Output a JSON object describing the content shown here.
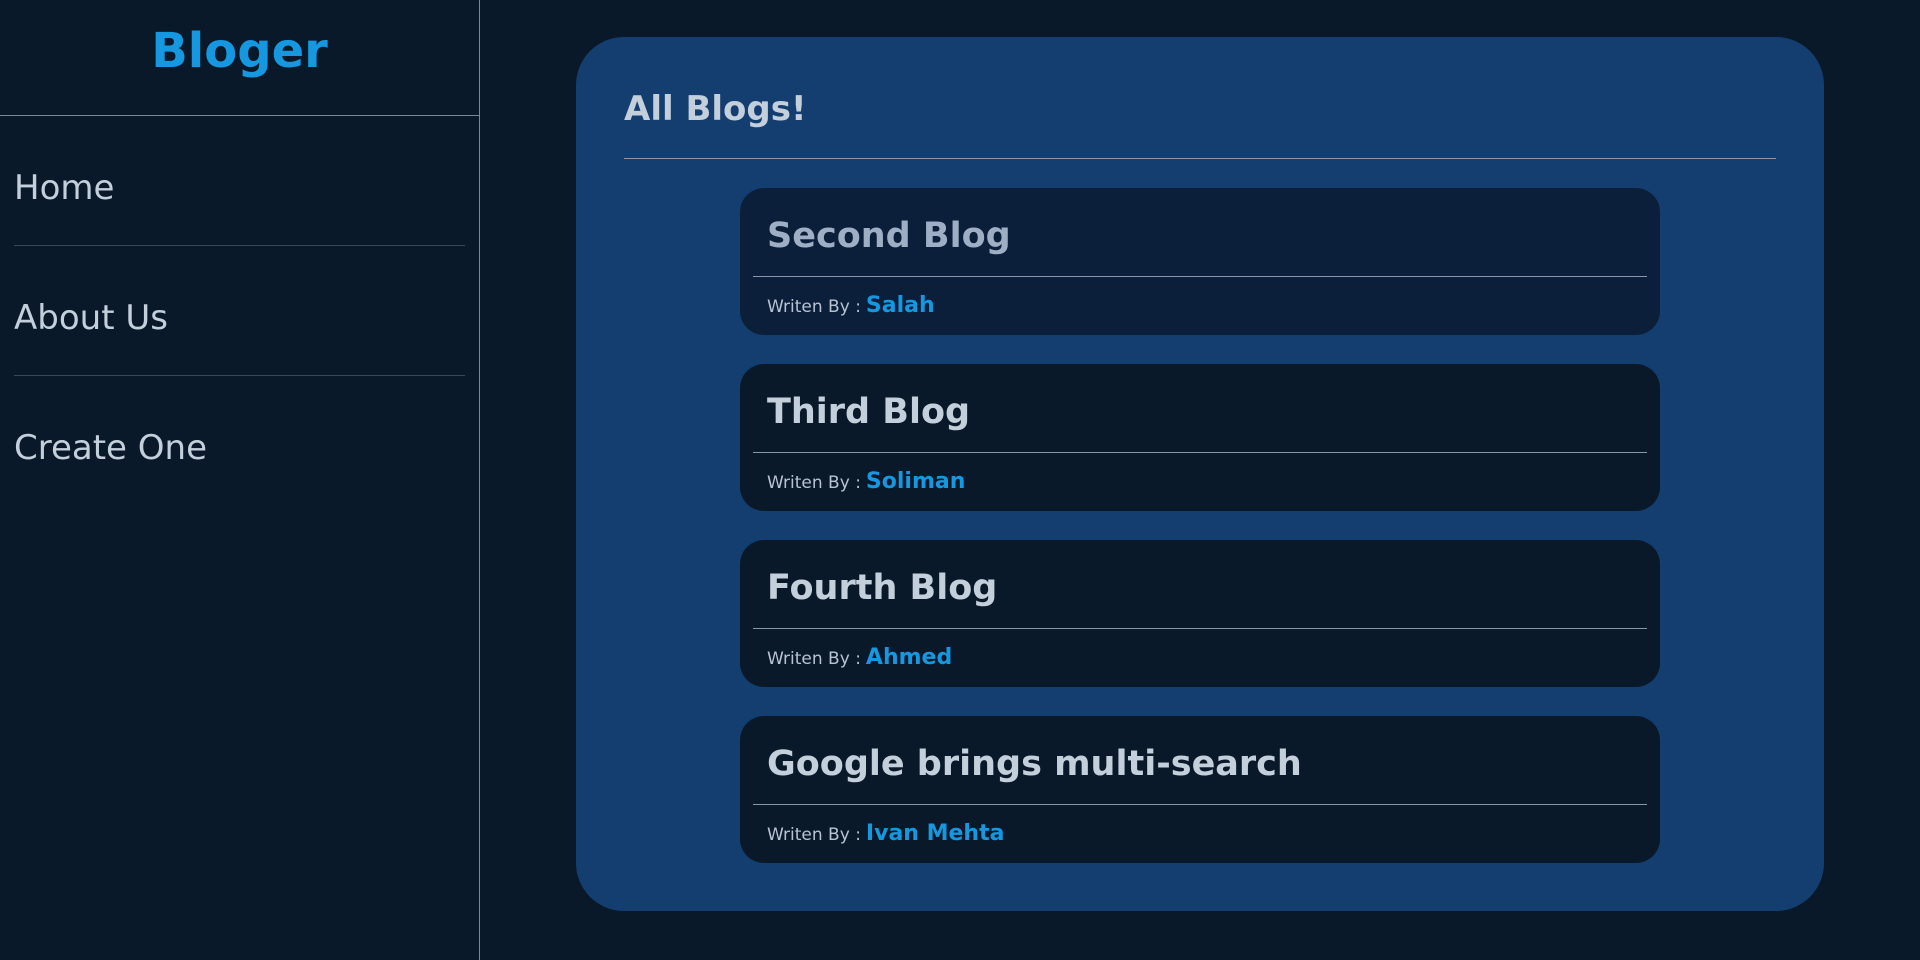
{
  "sidebar": {
    "brand": "Bloger",
    "nav": [
      {
        "label": "Home"
      },
      {
        "label": "About Us"
      },
      {
        "label": "Create One"
      }
    ]
  },
  "main": {
    "title": "All Blogs!",
    "written_by_label": "Writen By :",
    "blogs": [
      {
        "title": "Second Blog",
        "author": "Salah"
      },
      {
        "title": "Third Blog",
        "author": "Soliman"
      },
      {
        "title": "Fourth Blog",
        "author": "Ahmed"
      },
      {
        "title": "Google brings multi-search",
        "author": "Ivan Mehta"
      }
    ]
  },
  "colors": {
    "background": "#0a1929",
    "panel": "#133e6f",
    "accent": "#1598e0",
    "text": "#c4cfdc"
  }
}
